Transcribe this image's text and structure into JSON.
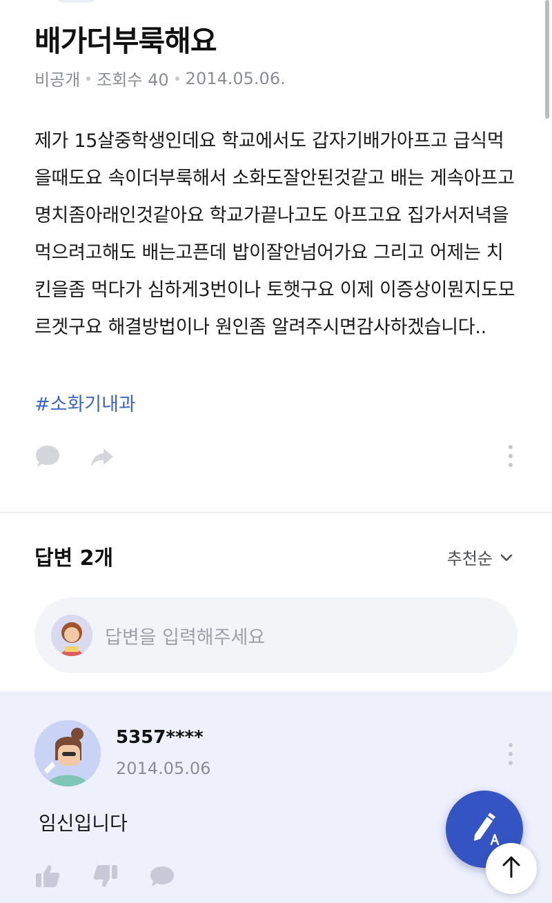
{
  "question": {
    "title": "배가더부룩해요",
    "visibility": "비공개",
    "views": "조회수 40",
    "date": "2014.05.06.",
    "body": "제가 15살중학생인데요 학교에서도 갑자기배가아프고 급식먹을때도요 속이더부룩해서 소화도잘안된것같고 배는 게속아프고 명치좀아래인것같아요 학교가끝나고도 아프고요 집가서저녁을 먹으려고해도 배는고픈데 밥이잘안넘어가요 그리고 어제는 치킨을좀 먹다가 심하게3번이나 토햇구요 이제 이증상이뭔지도모르겟구요 해결방법이나 원인좀 알려주시면감사하겠습니다..",
    "hashtag": "#소화기내과"
  },
  "answers": {
    "title": "답변 2개",
    "sort_label": "추천순",
    "input_placeholder": "답변을 입력해주세요",
    "first": {
      "author": "5357****",
      "date": "2014.05.06",
      "text": "임신입니다"
    }
  },
  "colors": {
    "accent": "#3554c4",
    "hashtag": "#3b66c8",
    "answer_bg": "#eef0fc",
    "muted": "#8a8d93"
  },
  "icons": [
    "comment-icon",
    "share-icon",
    "more-icon",
    "chevron-down-icon",
    "like-icon",
    "dislike-icon",
    "pen-icon",
    "arrow-up-icon"
  ]
}
